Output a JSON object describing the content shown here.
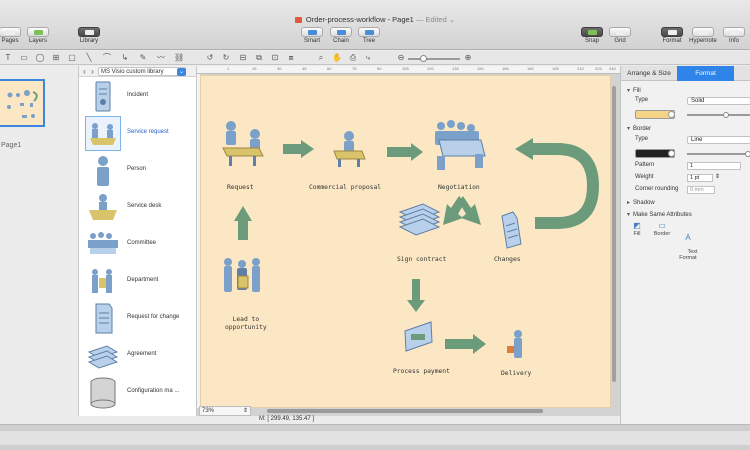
{
  "window": {
    "title": "Order-process-workflow - Page1",
    "edited": "— Edited",
    "toolbar": {
      "pages": "Pages",
      "layers": "Layers",
      "library": "Library",
      "smart": "Smart",
      "chain": "Chain",
      "tree": "Tree",
      "snap": "Snap",
      "grid": "Grid",
      "format": "Format",
      "hypernote": "Hypernote",
      "info": "Info"
    }
  },
  "pages_panel": {
    "page_label": "Page1"
  },
  "library": {
    "name": "MS Visio custom library",
    "items": [
      {
        "label": "Incident",
        "icon": "incident-icon",
        "selected": false
      },
      {
        "label": "Service request",
        "icon": "service-request-icon",
        "selected": true
      },
      {
        "label": "Person",
        "icon": "person-icon",
        "selected": false
      },
      {
        "label": "Service desk",
        "icon": "service-desk-icon",
        "selected": false
      },
      {
        "label": "Committee",
        "icon": "committee-icon",
        "selected": false
      },
      {
        "label": "Department",
        "icon": "department-icon",
        "selected": false
      },
      {
        "label": "Request for change",
        "icon": "request-for-change-icon",
        "selected": false
      },
      {
        "label": "Agreement",
        "icon": "agreement-icon",
        "selected": false
      },
      {
        "label": "Configuration ma ...",
        "icon": "configuration-management-icon",
        "selected": false
      }
    ]
  },
  "canvas": {
    "ruler_marks": [
      "1",
      "15",
      "30",
      "45",
      "60",
      "75",
      "90",
      "105",
      "120",
      "135",
      "150",
      "165",
      "180",
      "195",
      "210",
      "225",
      "240"
    ],
    "nodes": {
      "request": "Request",
      "commercial_proposal": "Commercial proposal",
      "negotiation": "Negotiation",
      "sign_contract": "Sign contract",
      "changes": "Changes",
      "lead": "Lead to\nopportunity",
      "process_payment": "Process payment",
      "delivery": "Delivery"
    },
    "colors": {
      "background": "#fbe7c4",
      "arrow": "#6b9b7b",
      "figure": "#7ba0c9"
    },
    "zoom": "73%",
    "mouse_coords": "M: [ 299.49, 135.47 ]"
  },
  "format_panel": {
    "tabs": [
      "Arrange & Size",
      "Format"
    ],
    "active_tab": "Format",
    "fill": {
      "title": "Fill",
      "type_label": "Type",
      "type_value": "Solid",
      "color": "#f5d488"
    },
    "border": {
      "title": "Border",
      "type_label": "Type",
      "type_value": "Line",
      "color": "#222222",
      "pattern_label": "Pattern",
      "pattern_value": "1",
      "weight_label": "Weight",
      "weight_value": "1 pt",
      "corner_label": "Corner rounding",
      "corner_value": "0 mm"
    },
    "shadow": {
      "title": "Shadow"
    },
    "make_same": {
      "title": "Make Same Attributes",
      "buttons": [
        "Fill",
        "Border",
        "Text\nFormat"
      ]
    }
  }
}
